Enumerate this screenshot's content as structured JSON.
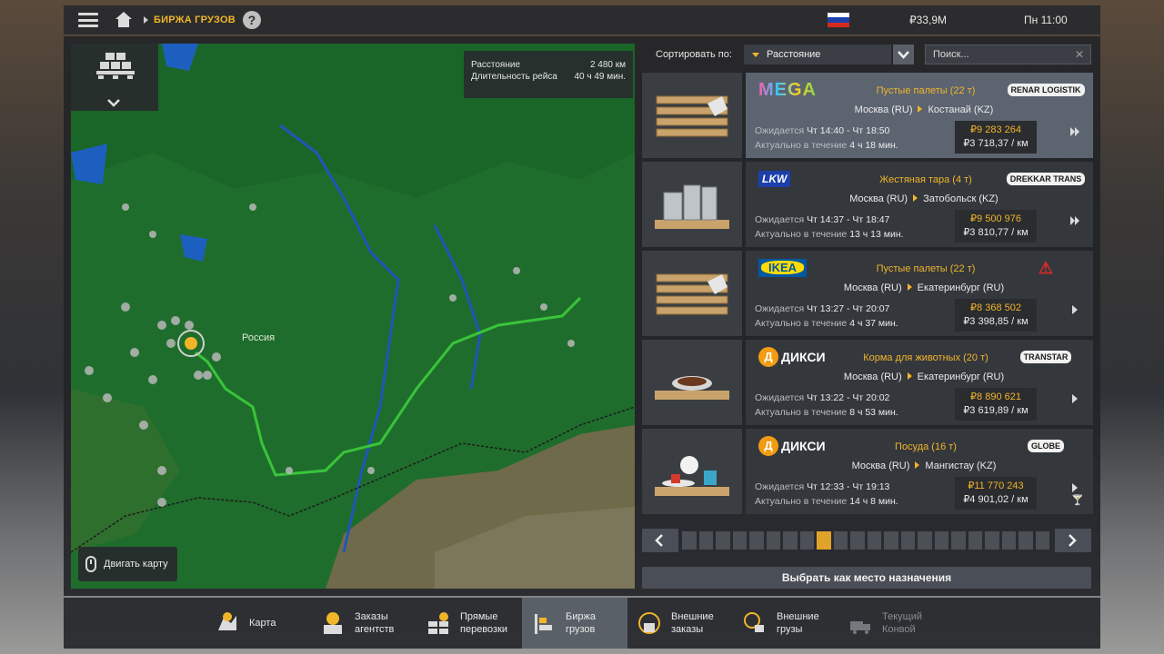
{
  "topbar": {
    "breadcrumb": "БИРЖА ГРУЗОВ",
    "help": "?",
    "money": "₽33,9M",
    "time": "Пн 11:00",
    "flag_colors": [
      "#ffffff",
      "#1c3faa",
      "#d52b1e"
    ]
  },
  "map": {
    "route_info": {
      "distance_label": "Расстояние",
      "distance_value": "2 480 км",
      "duration_label": "Длительность рейса",
      "duration_value": "40 ч 49 мин."
    },
    "country_label": "Россия",
    "move_map_label": "Двигать карту"
  },
  "sort": {
    "label": "Сортировать по:",
    "selected": "Расстояние",
    "search_placeholder": "Поиск..."
  },
  "jobs": [
    {
      "logo": "MEGA",
      "cargo": "Пустые палеты (22 т)",
      "company": "RENAR LOGISTIK",
      "from": "Москва (RU)",
      "to": "Костанай (KZ)",
      "expected_label": "Ожидается",
      "expected": "Чт 14:40 - Чт 18:50",
      "valid_label": "Актуально в течение",
      "valid": "4 ч 18 мин.",
      "pay": "₽9 283 264",
      "per_km": "₽3 718,37 / км",
      "thumb": "pallets",
      "selected": true,
      "action_icon": "fast-forward"
    },
    {
      "logo": "LKW",
      "cargo": "Жестяная тара (4 т)",
      "company": "DREKKAR TRANS",
      "from": "Москва (RU)",
      "to": "Затобольск (KZ)",
      "expected_label": "Ожидается",
      "expected": "Чт 14:37 - Чт 18:47",
      "valid_label": "Актуально в течение",
      "valid": "13 ч 13 мин.",
      "pay": "₽9 500 976",
      "per_km": "₽3 810,77 / км",
      "thumb": "cans",
      "selected": false,
      "action_icon": "fast-forward"
    },
    {
      "logo": "IKEA",
      "cargo": "Пустые палеты (22 т)",
      "company": "",
      "from": "Москва (RU)",
      "to": "Екатеринбург (RU)",
      "expected_label": "Ожидается",
      "expected": "Чт 13:27 - Чт 20:07",
      "valid_label": "Актуально в течение",
      "valid": "4 ч 37 мин.",
      "pay": "₽8 368 502",
      "per_km": "₽3 398,85 / км",
      "thumb": "pallets",
      "selected": false,
      "action_icon": "play"
    },
    {
      "logo": "ДИКСИ",
      "cargo": "Корма для животных (20 т)",
      "company": "TRANSTAR",
      "from": "Москва (RU)",
      "to": "Екатеринбург (RU)",
      "expected_label": "Ожидается",
      "expected": "Чт 13:22 - Чт 20:02",
      "valid_label": "Актуально в течение",
      "valid": "8 ч 53 мин.",
      "pay": "₽8 890 621",
      "per_km": "₽3 619,89 / км",
      "thumb": "petfood",
      "selected": false,
      "action_icon": "play"
    },
    {
      "logo": "ДИКСИ",
      "cargo": "Посуда (16 т)",
      "company": "GLOBE",
      "from": "Москва (RU)",
      "to": "Мангистау (KZ)",
      "expected_label": "Ожидается",
      "expected": "Чт 12:33 - Чт 19:13",
      "valid_label": "Актуально в течение",
      "valid": "14 ч 8 мин.",
      "pay": "₽11 770 243",
      "per_km": "₽4 901,02 / км",
      "thumb": "dishes",
      "selected": false,
      "action_icon": "play"
    }
  ],
  "pager": {
    "active_index": 8,
    "segment_count": 22
  },
  "set_destination": "Выбрать как место назначения",
  "bottom_nav": [
    {
      "label_1": "Карта",
      "label_2": "",
      "icon": "map-icon",
      "active": false,
      "disabled": false
    },
    {
      "label_1": "Заказы",
      "label_2": "агентств",
      "icon": "agency-orders-icon",
      "active": false,
      "disabled": false
    },
    {
      "label_1": "Прямые",
      "label_2": "перевозки",
      "icon": "direct-transport-icon",
      "active": false,
      "disabled": false
    },
    {
      "label_1": "Биржа",
      "label_2": "грузов",
      "icon": "cargo-exchange-icon",
      "active": true,
      "disabled": false
    },
    {
      "label_1": "Внешние",
      "label_2": "заказы",
      "icon": "external-orders-icon",
      "active": false,
      "disabled": false
    },
    {
      "label_1": "Внешние",
      "label_2": "грузы",
      "icon": "external-cargo-icon",
      "active": false,
      "disabled": false
    },
    {
      "label_1": "Текущий",
      "label_2": "Конвой",
      "icon": "convoy-icon",
      "active": false,
      "disabled": true
    }
  ],
  "colors": {
    "accent": "#f1b52a",
    "route": "#39c43a",
    "map_land": "#1d6b2a"
  }
}
